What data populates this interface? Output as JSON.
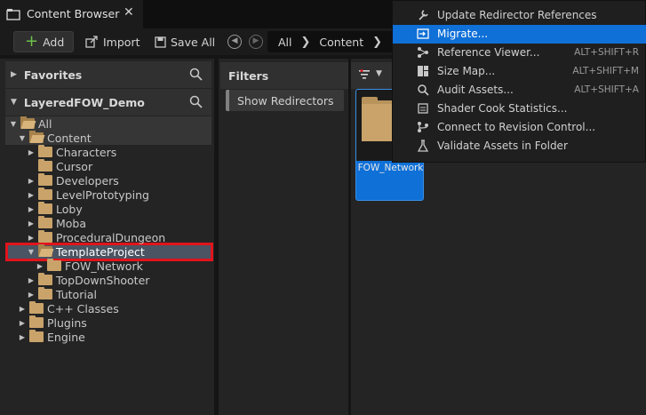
{
  "window": {
    "tab_title": "Content Browser"
  },
  "toolbar": {
    "add_label": "Add",
    "import_label": "Import",
    "save_all_label": "Save All",
    "breadcrumb": [
      "All",
      "Content"
    ]
  },
  "left_panel": {
    "favorites_label": "Favorites",
    "project_label": "LayeredFOW_Demo",
    "tree": [
      {
        "label": "All",
        "depth": 0,
        "expanded": true
      },
      {
        "label": "Content",
        "depth": 1,
        "expanded": true
      },
      {
        "label": "Characters",
        "depth": 2,
        "expanded": false
      },
      {
        "label": "Cursor",
        "depth": 2,
        "expanded": false
      },
      {
        "label": "Developers",
        "depth": 2,
        "expanded": false
      },
      {
        "label": "LevelPrototyping",
        "depth": 2,
        "expanded": false
      },
      {
        "label": "Loby",
        "depth": 2,
        "expanded": false
      },
      {
        "label": "Moba",
        "depth": 2,
        "expanded": false
      },
      {
        "label": "ProceduralDungeon",
        "depth": 2,
        "expanded": false
      },
      {
        "label": "TemplateProject",
        "depth": 2,
        "expanded": true,
        "selected": true
      },
      {
        "label": "FOW_Network",
        "depth": 3,
        "expanded": false
      },
      {
        "label": "TopDownShooter",
        "depth": 2,
        "expanded": false
      },
      {
        "label": "Tutorial",
        "depth": 2,
        "expanded": false
      },
      {
        "label": "C++ Classes",
        "depth": 1,
        "expanded": false
      },
      {
        "label": "Plugins",
        "depth": 1,
        "expanded": false
      },
      {
        "label": "Engine",
        "depth": 1,
        "expanded": false
      }
    ]
  },
  "filters_panel": {
    "header": "Filters",
    "show_redirectors_label": "Show Redirectors"
  },
  "content": {
    "assets": [
      {
        "name": "FOW_Network",
        "selected": true
      }
    ]
  },
  "context_menu": {
    "items": [
      {
        "label": "Update Redirector References",
        "shortcut": "",
        "icon": "wrench-icon"
      },
      {
        "label": "Migrate...",
        "shortcut": "",
        "icon": "migrate-icon",
        "highlighted": true
      },
      {
        "label": "Reference Viewer...",
        "shortcut": "ALT+SHIFT+R",
        "icon": "reference-viewer-icon"
      },
      {
        "label": "Size Map...",
        "shortcut": "ALT+SHIFT+M",
        "icon": "size-map-icon"
      },
      {
        "label": "Audit Assets...",
        "shortcut": "ALT+SHIFT+A",
        "icon": "audit-icon"
      },
      {
        "label": "Shader Cook Statistics...",
        "shortcut": "",
        "icon": "shader-stats-icon"
      },
      {
        "label": "Connect to Revision Control...",
        "shortcut": "",
        "icon": "revision-control-icon"
      },
      {
        "label": "Validate Assets in Folder",
        "shortcut": "",
        "icon": "validate-icon"
      }
    ]
  },
  "colors": {
    "accent": "#0f70d7",
    "selection_outline": "#e0141c",
    "folder": "#c9a36a",
    "add_plus": "#6cc24a"
  }
}
